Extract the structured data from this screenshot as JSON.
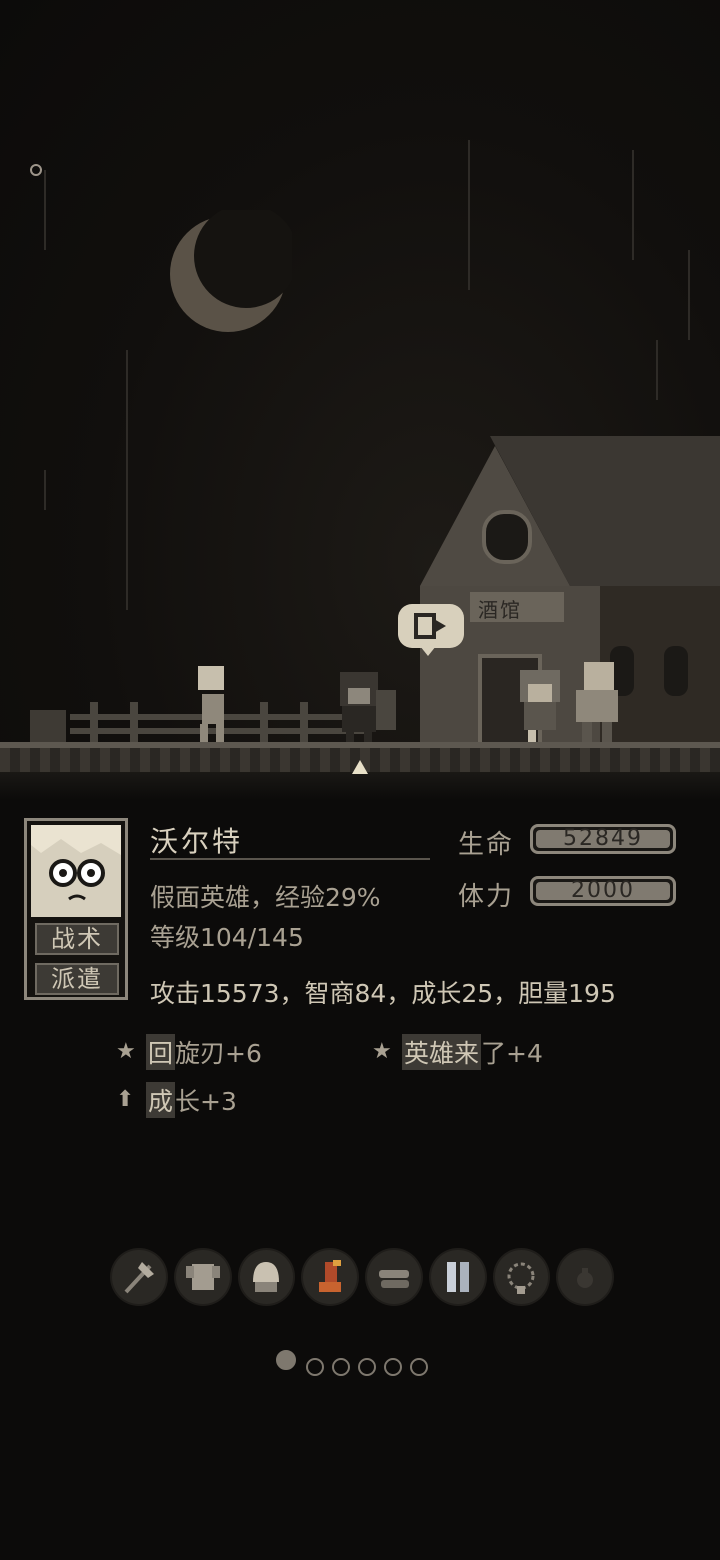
{
  "hero": {
    "name": "沃尔特",
    "title_exp": "假面英雄，经验29%",
    "level": "等级104/145",
    "attributes": "攻击15573，智商84，成长25，胆量195",
    "portrait_buttons": {
      "tactics": "战术",
      "dispatch": "派遣"
    }
  },
  "stats": {
    "hp": {
      "label": "生命",
      "value": "52849",
      "fill": 1.0
    },
    "stamina": {
      "label": "体力",
      "value": "2000",
      "fill": 1.0
    }
  },
  "skills": [
    {
      "icon": "star-icon",
      "highlight": "回",
      "rest": "旋刃+6"
    },
    {
      "icon": "star-icon",
      "highlight": "英雄来",
      "rest": "了+4"
    },
    {
      "icon": "arrow-up-icon",
      "highlight": "成",
      "rest": "长+3"
    }
  ],
  "scene": {
    "tavern_sign": "酒馆"
  },
  "equipment": [
    {
      "name": "axe-weapon-icon"
    },
    {
      "name": "armor-icon"
    },
    {
      "name": "helmet-icon"
    },
    {
      "name": "boots-icon"
    },
    {
      "name": "gloves-icon"
    },
    {
      "name": "greaves-icon"
    },
    {
      "name": "necklace-icon"
    },
    {
      "name": "potion-empty-icon"
    }
  ],
  "pager": {
    "total": 6,
    "active": 0
  },
  "colors": {
    "bg": "#0c0b0a",
    "text": "#a9a192",
    "accent": "#807a70"
  }
}
